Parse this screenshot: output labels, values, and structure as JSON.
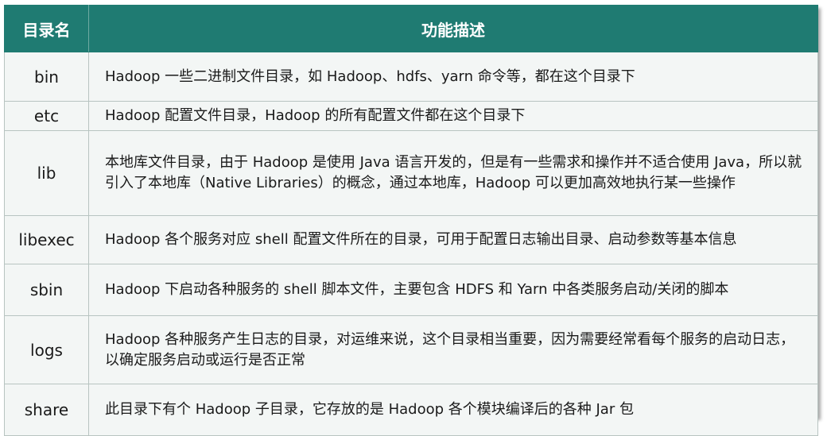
{
  "header": {
    "col_name": "目录名",
    "col_desc": "功能描述"
  },
  "rows": [
    {
      "name": "bin",
      "desc": "Hadoop 一些二进制文件目录，如 Hadoop、hdfs、yarn 命令等，都在这个目录下"
    },
    {
      "name": "etc",
      "desc": "Hadoop 配置文件目录，Hadoop 的所有配置文件都在这个目录下"
    },
    {
      "name": "lib",
      "desc": "本地库文件目录，由于 Hadoop 是使用 Java 语言开发的，但是有一些需求和操作并不适合使用 Java，所以就引入了本地库（Native Libraries）的概念，通过本地库，Hadoop 可以更加高效地执行某一些操作"
    },
    {
      "name": "libexec",
      "desc": "Hadoop 各个服务对应 shell 配置文件所在的目录，可用于配置日志输出目录、启动参数等基本信息"
    },
    {
      "name": "sbin",
      "desc": "Hadoop 下启动各种服务的 shell 脚本文件，主要包含 HDFS 和 Yarn 中各类服务启动/关闭的脚本"
    },
    {
      "name": "logs",
      "desc": "Hadoop 各种服务产生日志的目录，对运维来说，这个目录相当重要，因为需要经常看每个服务的启动日志，以确定服务启动或运行是否正常"
    },
    {
      "name": "share",
      "desc": "此目录下有个 Hadoop 子目录，它存放的是 Hadoop 各个模块编译后的各种 Jar 包"
    }
  ],
  "colors": {
    "header_bg": "#1f7b72",
    "header_text": "#ffffff",
    "cell_bg": "#f3f6f5",
    "border": "#b8c4c1"
  }
}
